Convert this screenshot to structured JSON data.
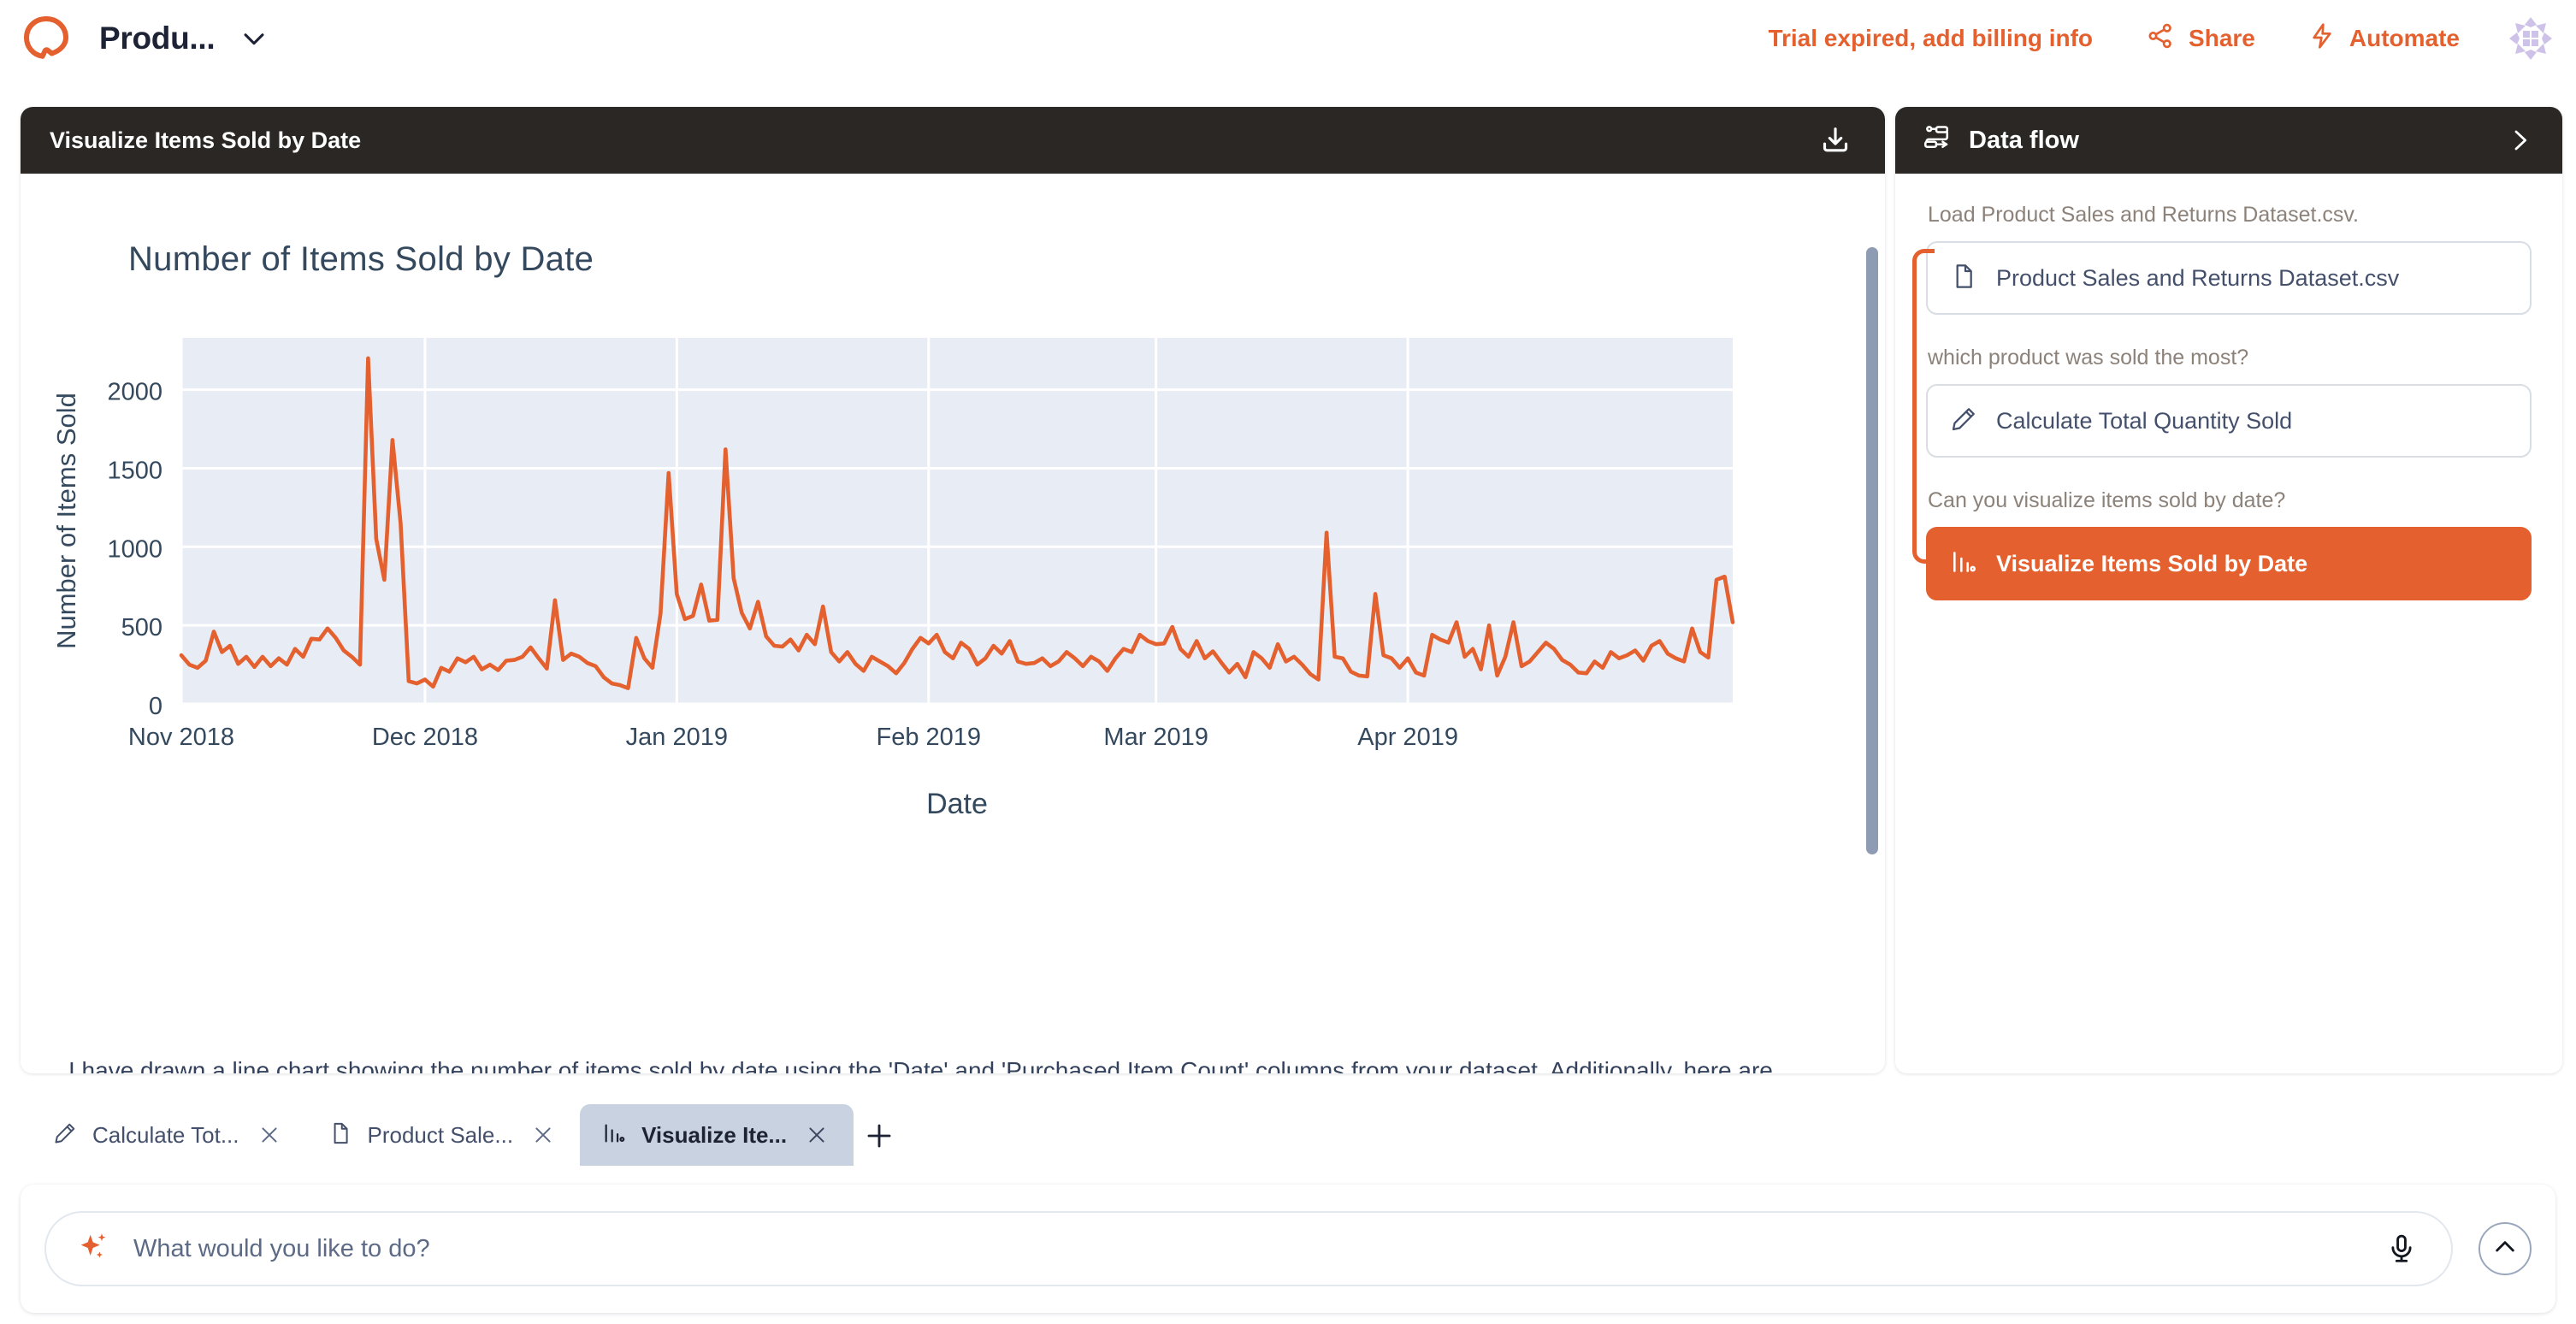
{
  "header": {
    "logo_icon": "quill-q-logo",
    "project_title": "Produ...",
    "project_caret_icon": "chevron-down-icon",
    "trial_notice": "Trial expired, add billing info",
    "share_label": "Share",
    "share_icon": "share-nodes-icon",
    "automate_label": "Automate",
    "automate_icon": "lightning-bolt-icon",
    "avatar_icon": "user-avatar-pattern"
  },
  "chart_panel": {
    "title": "Visualize Items Sold by Date",
    "download_icon": "download-icon",
    "answer_text": "I have drawn a line chart showing the number of items sold by date using the 'Date' and 'Purchased Item Count' columns from your dataset. Additionally, here are some summary statistics for the daily sales:",
    "scrollbar_icon": "vertical-scrollbar"
  },
  "data_flow": {
    "title": "Data flow",
    "header_icon": "data-flow-icon",
    "expand_icon": "chevron-right-icon",
    "steps": [
      {
        "label": "Load Product Sales and Returns Dataset.csv.",
        "card": "Product Sales and Returns Dataset.csv",
        "icon": "file-icon",
        "active": false
      },
      {
        "label": "which product was sold the most?",
        "card": "Calculate Total Quantity Sold",
        "icon": "pencil-icon",
        "active": false
      },
      {
        "label": "Can you visualize items sold by date?",
        "card": "Visualize Items Sold by Date",
        "icon": "bar-chart-icon",
        "active": true
      }
    ]
  },
  "tabs": {
    "items": [
      {
        "label": "Calculate Tot...",
        "icon": "pencil-icon",
        "close_icon": "close-icon",
        "active": false
      },
      {
        "label": "Product Sale...",
        "icon": "file-icon",
        "close_icon": "close-icon",
        "active": false
      },
      {
        "label": "Visualize Ite...",
        "icon": "bar-chart-icon",
        "close_icon": "close-icon",
        "active": true
      }
    ],
    "add_icon": "plus-icon"
  },
  "composer": {
    "sparkle_icon": "sparkle-icon",
    "placeholder": "What would you like to do?",
    "value": "",
    "mic_icon": "microphone-icon",
    "send_icon": "chevron-up-icon"
  },
  "colors": {
    "accent_orange": "#e4602f",
    "dark_header": "#2b2725",
    "plot_bg": "#e8ecf4",
    "text_navy": "#34495e",
    "avatar_purple": "#cfc2e8"
  },
  "chart_data": {
    "type": "line",
    "title": "Number of Items Sold by Date",
    "xlabel": "Date",
    "ylabel": "Number of Items Sold",
    "grid": true,
    "legend": "none",
    "line_color": "#e4602f",
    "ylim": [
      0,
      2330
    ],
    "yticks": [
      0,
      500,
      1000,
      1500,
      2000
    ],
    "xticks": [
      "Nov 2018",
      "Dec 2018",
      "Jan 2019",
      "Feb 2019",
      "Mar 2019",
      "Apr 2019"
    ],
    "xtick_index": [
      0,
      30,
      61,
      92,
      120,
      151
    ],
    "x_start": "2018-11-01",
    "x_end": "2019-05-06",
    "values": [
      310,
      250,
      230,
      275,
      460,
      330,
      370,
      255,
      300,
      235,
      300,
      240,
      290,
      250,
      350,
      300,
      415,
      410,
      480,
      420,
      340,
      300,
      250,
      2200,
      1050,
      790,
      1680,
      1150,
      145,
      130,
      155,
      110,
      230,
      205,
      290,
      265,
      300,
      220,
      250,
      215,
      275,
      280,
      300,
      360,
      290,
      225,
      660,
      280,
      320,
      300,
      260,
      240,
      170,
      130,
      120,
      100,
      420,
      290,
      230,
      575,
      1470,
      700,
      540,
      560,
      760,
      530,
      535,
      1620,
      800,
      580,
      480,
      650,
      430,
      370,
      365,
      410,
      340,
      440,
      380,
      620,
      330,
      270,
      330,
      255,
      210,
      300,
      270,
      240,
      195,
      260,
      350,
      420,
      385,
      440,
      330,
      290,
      390,
      350,
      250,
      290,
      370,
      320,
      400,
      270,
      255,
      260,
      290,
      240,
      270,
      330,
      290,
      240,
      300,
      270,
      210,
      290,
      350,
      330,
      440,
      400,
      380,
      385,
      490,
      350,
      300,
      400,
      290,
      335,
      265,
      200,
      255,
      170,
      330,
      290,
      230,
      380,
      270,
      300,
      250,
      190,
      155,
      1090,
      300,
      290,
      205,
      180,
      175,
      700,
      310,
      290,
      230,
      290,
      200,
      180,
      440,
      410,
      390,
      520,
      300,
      350,
      220,
      500,
      180,
      300,
      520,
      240,
      270,
      330,
      390,
      350,
      280,
      250,
      200,
      195,
      270,
      230,
      330,
      290,
      310,
      340,
      275,
      370,
      400,
      320,
      290,
      270,
      480,
      330,
      295,
      790,
      810,
      520
    ]
  }
}
